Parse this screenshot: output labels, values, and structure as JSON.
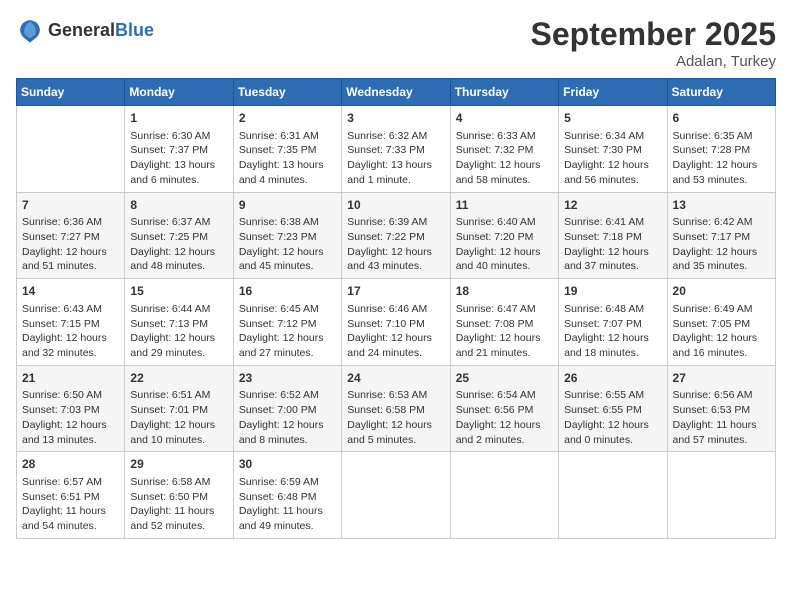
{
  "header": {
    "logo_general": "General",
    "logo_blue": "Blue",
    "title": "September 2025",
    "location": "Adalan, Turkey"
  },
  "columns": [
    "Sunday",
    "Monday",
    "Tuesday",
    "Wednesday",
    "Thursday",
    "Friday",
    "Saturday"
  ],
  "weeks": [
    [
      {
        "day": "",
        "content": ""
      },
      {
        "day": "1",
        "content": "Sunrise: 6:30 AM\nSunset: 7:37 PM\nDaylight: 13 hours\nand 6 minutes."
      },
      {
        "day": "2",
        "content": "Sunrise: 6:31 AM\nSunset: 7:35 PM\nDaylight: 13 hours\nand 4 minutes."
      },
      {
        "day": "3",
        "content": "Sunrise: 6:32 AM\nSunset: 7:33 PM\nDaylight: 13 hours\nand 1 minute."
      },
      {
        "day": "4",
        "content": "Sunrise: 6:33 AM\nSunset: 7:32 PM\nDaylight: 12 hours\nand 58 minutes."
      },
      {
        "day": "5",
        "content": "Sunrise: 6:34 AM\nSunset: 7:30 PM\nDaylight: 12 hours\nand 56 minutes."
      },
      {
        "day": "6",
        "content": "Sunrise: 6:35 AM\nSunset: 7:28 PM\nDaylight: 12 hours\nand 53 minutes."
      }
    ],
    [
      {
        "day": "7",
        "content": "Sunrise: 6:36 AM\nSunset: 7:27 PM\nDaylight: 12 hours\nand 51 minutes."
      },
      {
        "day": "8",
        "content": "Sunrise: 6:37 AM\nSunset: 7:25 PM\nDaylight: 12 hours\nand 48 minutes."
      },
      {
        "day": "9",
        "content": "Sunrise: 6:38 AM\nSunset: 7:23 PM\nDaylight: 12 hours\nand 45 minutes."
      },
      {
        "day": "10",
        "content": "Sunrise: 6:39 AM\nSunset: 7:22 PM\nDaylight: 12 hours\nand 43 minutes."
      },
      {
        "day": "11",
        "content": "Sunrise: 6:40 AM\nSunset: 7:20 PM\nDaylight: 12 hours\nand 40 minutes."
      },
      {
        "day": "12",
        "content": "Sunrise: 6:41 AM\nSunset: 7:18 PM\nDaylight: 12 hours\nand 37 minutes."
      },
      {
        "day": "13",
        "content": "Sunrise: 6:42 AM\nSunset: 7:17 PM\nDaylight: 12 hours\nand 35 minutes."
      }
    ],
    [
      {
        "day": "14",
        "content": "Sunrise: 6:43 AM\nSunset: 7:15 PM\nDaylight: 12 hours\nand 32 minutes."
      },
      {
        "day": "15",
        "content": "Sunrise: 6:44 AM\nSunset: 7:13 PM\nDaylight: 12 hours\nand 29 minutes."
      },
      {
        "day": "16",
        "content": "Sunrise: 6:45 AM\nSunset: 7:12 PM\nDaylight: 12 hours\nand 27 minutes."
      },
      {
        "day": "17",
        "content": "Sunrise: 6:46 AM\nSunset: 7:10 PM\nDaylight: 12 hours\nand 24 minutes."
      },
      {
        "day": "18",
        "content": "Sunrise: 6:47 AM\nSunset: 7:08 PM\nDaylight: 12 hours\nand 21 minutes."
      },
      {
        "day": "19",
        "content": "Sunrise: 6:48 AM\nSunset: 7:07 PM\nDaylight: 12 hours\nand 18 minutes."
      },
      {
        "day": "20",
        "content": "Sunrise: 6:49 AM\nSunset: 7:05 PM\nDaylight: 12 hours\nand 16 minutes."
      }
    ],
    [
      {
        "day": "21",
        "content": "Sunrise: 6:50 AM\nSunset: 7:03 PM\nDaylight: 12 hours\nand 13 minutes."
      },
      {
        "day": "22",
        "content": "Sunrise: 6:51 AM\nSunset: 7:01 PM\nDaylight: 12 hours\nand 10 minutes."
      },
      {
        "day": "23",
        "content": "Sunrise: 6:52 AM\nSunset: 7:00 PM\nDaylight: 12 hours\nand 8 minutes."
      },
      {
        "day": "24",
        "content": "Sunrise: 6:53 AM\nSunset: 6:58 PM\nDaylight: 12 hours\nand 5 minutes."
      },
      {
        "day": "25",
        "content": "Sunrise: 6:54 AM\nSunset: 6:56 PM\nDaylight: 12 hours\nand 2 minutes."
      },
      {
        "day": "26",
        "content": "Sunrise: 6:55 AM\nSunset: 6:55 PM\nDaylight: 12 hours\nand 0 minutes."
      },
      {
        "day": "27",
        "content": "Sunrise: 6:56 AM\nSunset: 6:53 PM\nDaylight: 11 hours\nand 57 minutes."
      }
    ],
    [
      {
        "day": "28",
        "content": "Sunrise: 6:57 AM\nSunset: 6:51 PM\nDaylight: 11 hours\nand 54 minutes."
      },
      {
        "day": "29",
        "content": "Sunrise: 6:58 AM\nSunset: 6:50 PM\nDaylight: 11 hours\nand 52 minutes."
      },
      {
        "day": "30",
        "content": "Sunrise: 6:59 AM\nSunset: 6:48 PM\nDaylight: 11 hours\nand 49 minutes."
      },
      {
        "day": "",
        "content": ""
      },
      {
        "day": "",
        "content": ""
      },
      {
        "day": "",
        "content": ""
      },
      {
        "day": "",
        "content": ""
      }
    ]
  ]
}
